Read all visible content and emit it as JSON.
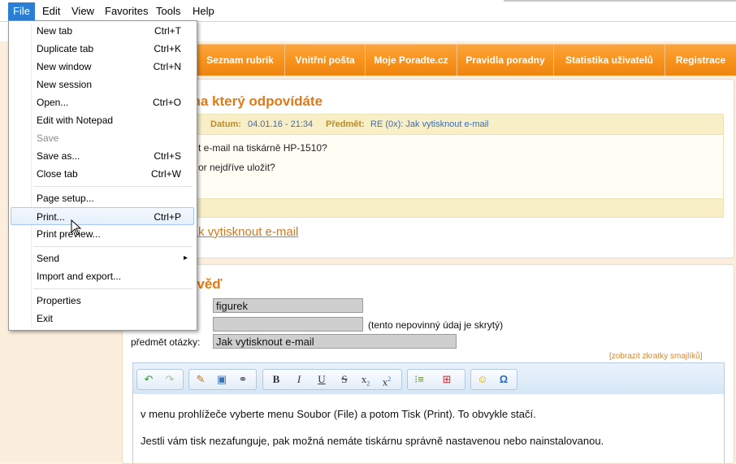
{
  "menubar": {
    "items": [
      "File",
      "Edit",
      "View",
      "Favorites",
      "Tools",
      "Help"
    ]
  },
  "file_menu": {
    "items": [
      {
        "label": "New tab",
        "shortcut": "Ctrl+T"
      },
      {
        "label": "Duplicate tab",
        "shortcut": "Ctrl+K"
      },
      {
        "label": "New window",
        "shortcut": "Ctrl+N"
      },
      {
        "label": "New session",
        "shortcut": ""
      },
      {
        "label": "Open...",
        "shortcut": "Ctrl+O"
      },
      {
        "label": "Edit with Notepad",
        "shortcut": ""
      },
      {
        "label": "Save",
        "shortcut": ""
      },
      {
        "label": "Save as...",
        "shortcut": "Ctrl+S"
      },
      {
        "label": "Close tab",
        "shortcut": "Ctrl+W"
      },
      {
        "label": "Page setup...",
        "shortcut": ""
      },
      {
        "label": "Print...",
        "shortcut": "Ctrl+P"
      },
      {
        "label": "Print preview...",
        "shortcut": ""
      },
      {
        "label": "Send",
        "shortcut": ""
      },
      {
        "label": "Import and export...",
        "shortcut": ""
      },
      {
        "label": "Properties",
        "shortcut": ""
      },
      {
        "label": "Exit",
        "shortcut": ""
      }
    ],
    "disabled_item": "Save",
    "highlighted_item": "Print...",
    "submenu_arrow": "▸"
  },
  "site_nav": {
    "items": [
      "Seznam rubrik",
      "Vnitřní pošta",
      "Moje Poradte.cz",
      "Pravidla poradny",
      "Statistika uživatelů",
      "Registrace"
    ]
  },
  "question_panel": {
    "heading_visible": ", na který odpovídáte",
    "meta_author_tail": "t",
    "date_label": "Datum:",
    "date_value": "04.01.16 - 21:34",
    "subject_label": "Předmět:",
    "subject_value": "RE (0x): Jak vytisknout e-mail",
    "body_line1": "t e-mail na tiskárně HP-1510?",
    "body_line2": "or nejdříve uložit?",
    "link_prefix": ":",
    "link_text": "Jak vytisknout e-mail"
  },
  "answer_panel": {
    "heading_visible": "ověď",
    "name_value": "figurek",
    "email_value": "",
    "email_note": "(tento nepovinný údaj je skrytý)",
    "subject_label": "předmět otázky:",
    "subject_value": "Jak vytisknout e-mail",
    "smileys_link": "[zobrazit zkratky smajlíků]",
    "editor_line1": "v menu prohlížeče vyberte menu Soubor (File) a potom Tisk (Print). To obvykle stačí.",
    "editor_line2": "Jestli vám tisk nezafunguje, pak možná nemáte tiskárnu správně nastavenou nebo nainstalovanou."
  },
  "editor_toolbar": {
    "bold": "B",
    "italic": "I",
    "underline": "U",
    "strike": "S",
    "subscript": "x",
    "superscript": "x",
    "omega": "Ω"
  },
  "colors": {
    "accent_orange": "#f7941d",
    "menu_highlight": "#2a7fd4",
    "heading_orange": "#e07a18"
  }
}
